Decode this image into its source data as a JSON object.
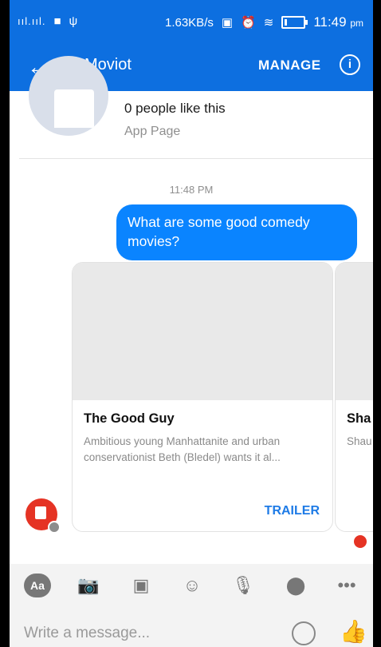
{
  "status_bar": {
    "network_speed": "1.63KB/s",
    "time": "11:49",
    "time_suffix": "pm",
    "signal": "ııl.ııl.",
    "battery_level": 0.15
  },
  "app_bar": {
    "title": "Moviot",
    "manage_label": "MANAGE",
    "info_label": "i"
  },
  "page_header": {
    "likes_text": "0 people like this",
    "subtitle": "App Page"
  },
  "thread": {
    "timestamp": "11:48 PM",
    "messages": [
      {
        "from": "user",
        "text": "What are some good comedy movies?"
      }
    ]
  },
  "cards": [
    {
      "title": "The Good Guy",
      "description": "Ambitious young Manhattanite and urban conservationist Beth (Bledel) wants it al...",
      "button": "TRAILER"
    },
    {
      "title": "Sha",
      "description": "Shau to Zo Wrig"
    }
  ],
  "composer": {
    "placeholder": "Write a message..."
  },
  "colors": {
    "brand": "#0d6fe0",
    "bubble": "#0a84ff",
    "accent": "#e53324"
  }
}
